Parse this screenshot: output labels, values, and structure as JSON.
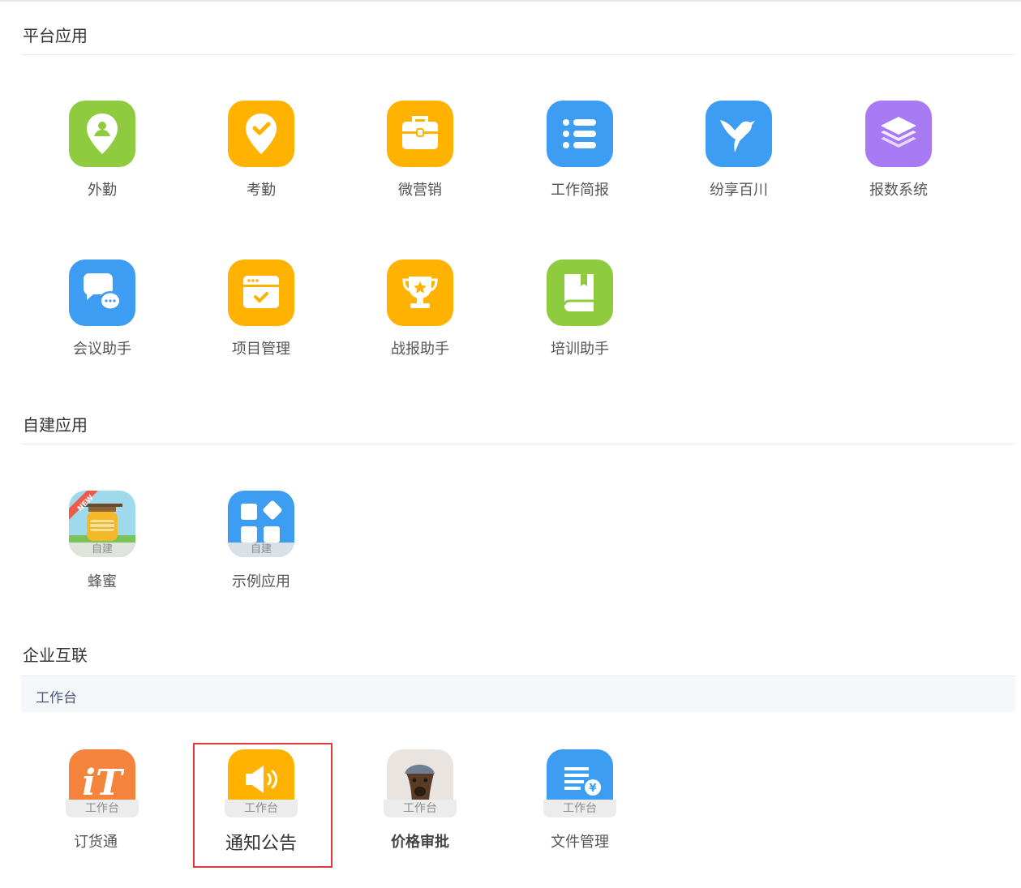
{
  "sections": {
    "platform": {
      "title": "平台应用"
    },
    "custom": {
      "title": "自建应用"
    },
    "interconnect": {
      "title": "企业互联",
      "subtab": "工作台"
    }
  },
  "platform_apps": [
    {
      "label": "外勤",
      "icon": "location-person-icon",
      "color": "#8fcb3f"
    },
    {
      "label": "考勤",
      "icon": "location-check-icon",
      "color": "#ffb300"
    },
    {
      "label": "微营销",
      "icon": "briefcase-icon",
      "color": "#ffb300"
    },
    {
      "label": "工作简报",
      "icon": "list-icon",
      "color": "#3d9df2"
    },
    {
      "label": "纷享百川",
      "icon": "hummingbird-icon",
      "color": "#3d9df2"
    },
    {
      "label": "报数系统",
      "icon": "layers-icon",
      "color": "#a77af3"
    },
    {
      "label": "会议助手",
      "icon": "chat-bubbles-icon",
      "color": "#3d9df2"
    },
    {
      "label": "项目管理",
      "icon": "calendar-check-icon",
      "color": "#ffb300"
    },
    {
      "label": "战报助手",
      "icon": "trophy-icon",
      "color": "#ffb300"
    },
    {
      "label": "培训助手",
      "icon": "book-icon",
      "color": "#8fcb3f"
    }
  ],
  "custom_apps": [
    {
      "label": "蜂蜜",
      "badge": "自建",
      "ribbon": "NEW",
      "icon": "honey-jar-icon"
    },
    {
      "label": "示例应用",
      "badge": "自建",
      "icon": "app-grid-icon",
      "color": "#3d9df2"
    }
  ],
  "workspace_apps": [
    {
      "label": "订货通",
      "badge": "工作台",
      "icon": "it-logo-icon",
      "logo_text": "iT",
      "color": "#f4843c"
    },
    {
      "label": "通知公告",
      "badge": "工作台",
      "icon": "speaker-icon",
      "color": "#ffb300",
      "highlighted": true
    },
    {
      "label": "价格审批",
      "badge": "工作台",
      "icon": "dog-photo-icon"
    },
    {
      "label": "文件管理",
      "badge": "工作台",
      "icon": "document-yen-icon",
      "color": "#3d9df2"
    }
  ]
}
